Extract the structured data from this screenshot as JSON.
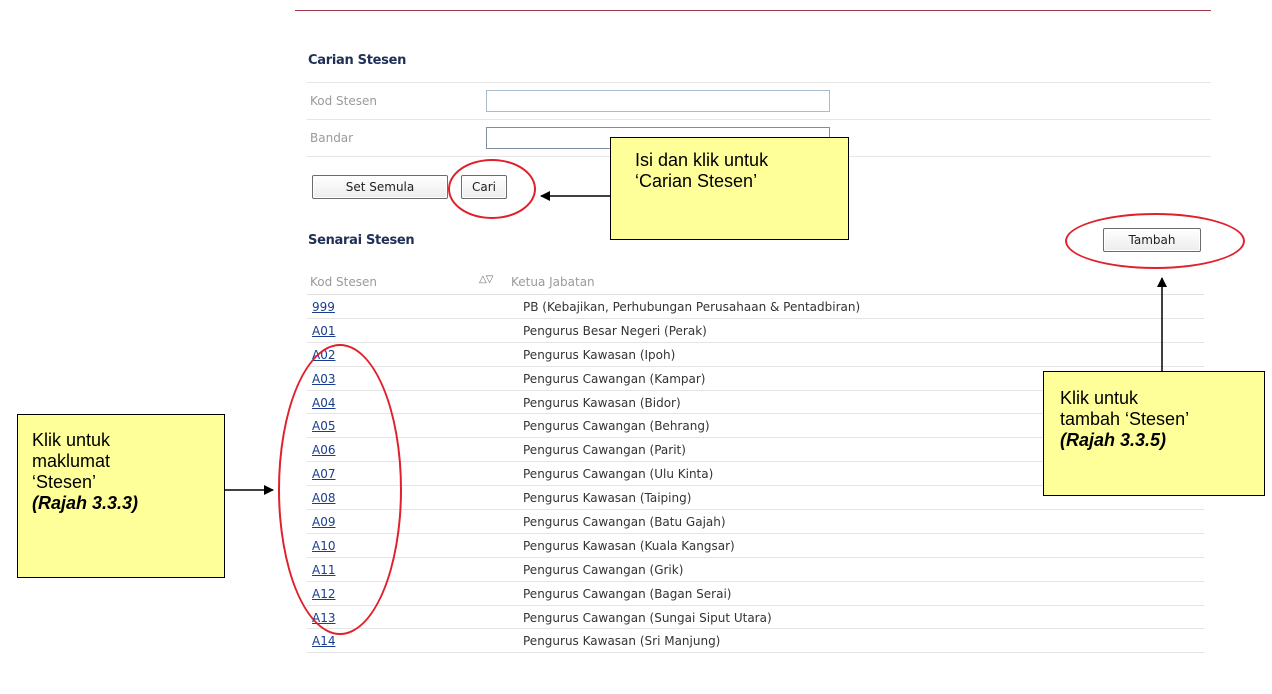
{
  "search": {
    "title": "Carian Stesen",
    "kod_label": "Kod Stesen",
    "kod_value": "",
    "bandar_label": "Bandar",
    "bandar_value": "",
    "reset_button": "Set Semula",
    "search_button": "Cari"
  },
  "list": {
    "title": "Senarai Stesen",
    "add_button": "Tambah",
    "col_code": "Kod Stesen",
    "col_head": "Ketua Jabatan",
    "rows": [
      {
        "code": "999",
        "name": "PB (Kebajikan, Perhubungan Perusahaan & Pentadbiran)"
      },
      {
        "code": "A01",
        "name": "Pengurus Besar Negeri (Perak)"
      },
      {
        "code": "A02",
        "name": "Pengurus Kawasan (Ipoh)"
      },
      {
        "code": "A03",
        "name": "Pengurus Cawangan (Kampar)"
      },
      {
        "code": "A04",
        "name": "Pengurus Kawasan (Bidor)"
      },
      {
        "code": "A05",
        "name": "Pengurus Cawangan (Behrang)"
      },
      {
        "code": "A06",
        "name": "Pengurus Cawangan (Parit)"
      },
      {
        "code": "A07",
        "name": "Pengurus Cawangan (Ulu Kinta)"
      },
      {
        "code": "A08",
        "name": "Pengurus Kawasan (Taiping)"
      },
      {
        "code": "A09",
        "name": "Pengurus Cawangan (Batu Gajah)"
      },
      {
        "code": "A10",
        "name": "Pengurus Kawasan (Kuala Kangsar)"
      },
      {
        "code": "A11",
        "name": "Pengurus Cawangan (Grik)"
      },
      {
        "code": "A12",
        "name": "Pengurus Cawangan (Bagan Serai)"
      },
      {
        "code": "A13",
        "name": "Pengurus Cawangan (Sungai Siput Utara)"
      },
      {
        "code": "A14",
        "name": "Pengurus Kawasan (Sri Manjung)"
      }
    ]
  },
  "annotations": {
    "search_note_line1": "Isi dan klik untuk",
    "search_note_line2": "‘Carian Stesen’",
    "add_note_line1": "Klik untuk",
    "add_note_line2": "tambah ‘Stesen’",
    "add_note_line3": "(Rajah 3.3.5)",
    "info_note_line1": "Klik untuk",
    "info_note_line2": "maklumat",
    "info_note_line3": "‘Stesen’",
    "info_note_line4": "(Rajah 3.3.3)"
  },
  "colors": {
    "highlight_ring": "#e0202a",
    "callout_fill": "#ffff99",
    "link": "#1a3d8f",
    "header_line": "#a0384c"
  }
}
